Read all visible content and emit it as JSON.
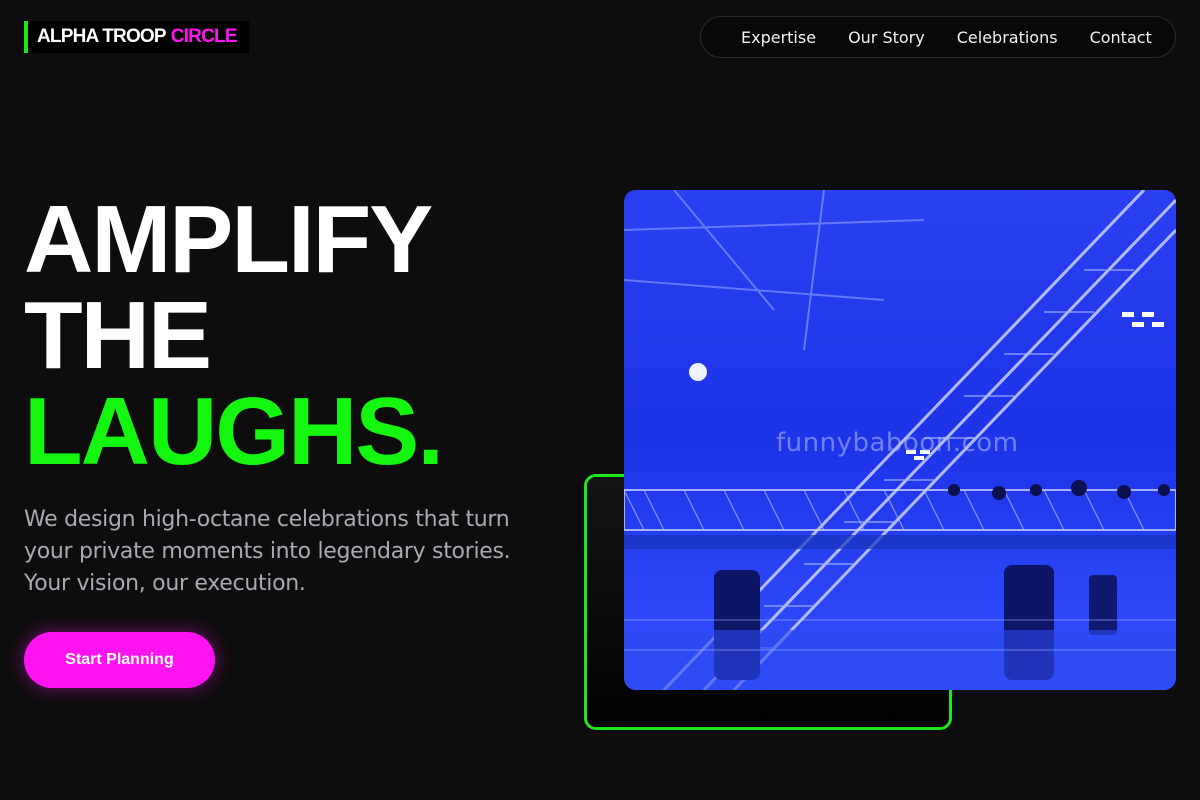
{
  "brand": {
    "name_part1": "ALPHA TROOP",
    "name_part2": "CIRCLE",
    "accent_green": "#22e61c",
    "accent_magenta": "#ff14f0"
  },
  "nav": {
    "items": [
      {
        "label": "Expertise"
      },
      {
        "label": "Our Story"
      },
      {
        "label": "Celebrations"
      },
      {
        "label": "Contact"
      }
    ]
  },
  "hero": {
    "line1": "AMPLIFY",
    "line2": "THE",
    "line3": "LAUGHS.",
    "subtitle": "We design high-octane celebrations that turn your private moments into legendary stories. Your vision, our execution.",
    "cta_label": "Start Planning"
  },
  "media": {
    "watermark": "funnybaboon.com"
  }
}
